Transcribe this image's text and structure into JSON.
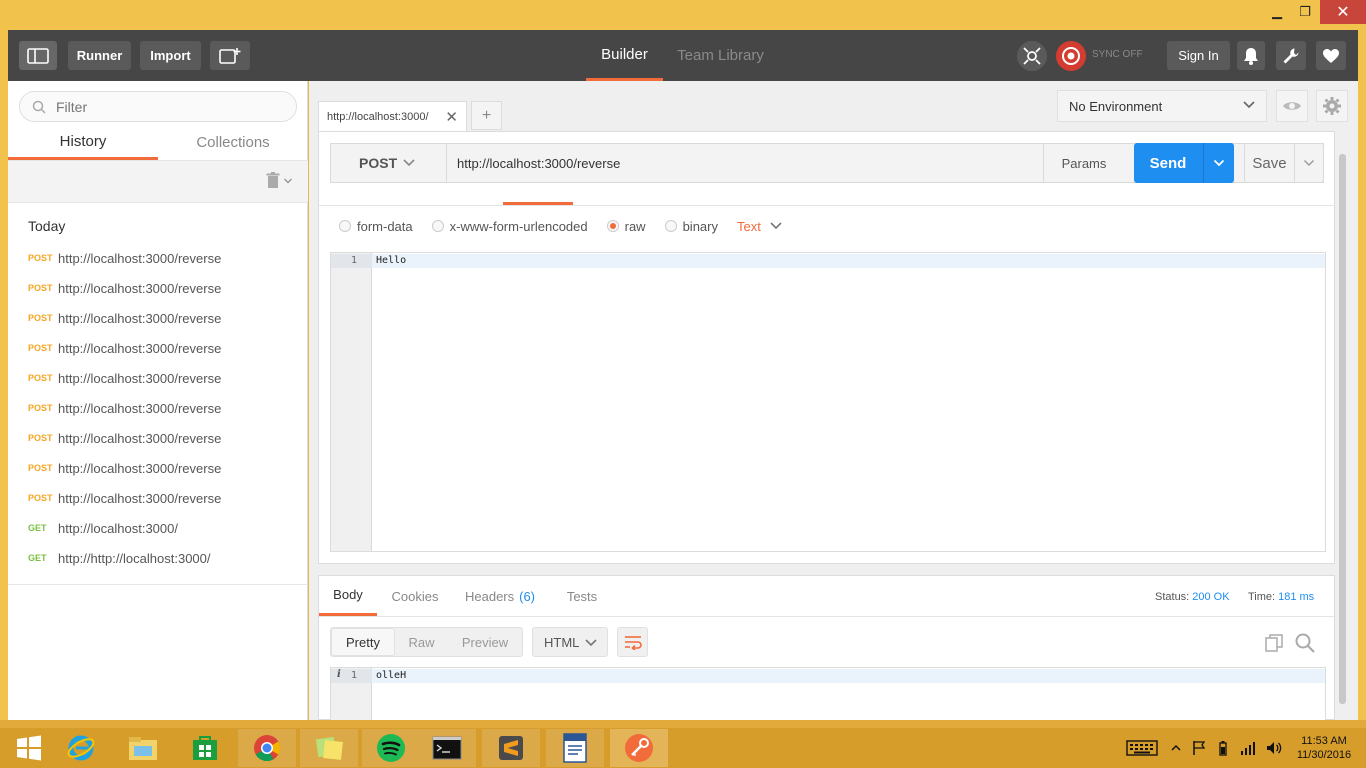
{
  "window": {
    "minimize_glyph": "▁",
    "maximize_glyph": "❐",
    "close_glyph": "✕"
  },
  "header": {
    "runner_label": "Runner",
    "import_label": "Import",
    "builder_label": "Builder",
    "team_library_label": "Team Library",
    "sync_label": "SYNC OFF",
    "sign_in_label": "Sign In",
    "icons": [
      "sidebar-toggle-icon",
      "new-window-icon",
      "interceptor-icon",
      "sync-icon",
      "bell-icon",
      "wrench-icon",
      "heart-icon"
    ],
    "accent": "#f26b3a"
  },
  "sidebar": {
    "filter_placeholder": "Filter",
    "tabs": [
      {
        "label": "History"
      },
      {
        "label": "Collections"
      }
    ],
    "today_label": "Today",
    "history": [
      {
        "method": "POST",
        "url": "http://localhost:3000/reverse"
      },
      {
        "method": "POST",
        "url": "http://localhost:3000/reverse"
      },
      {
        "method": "POST",
        "url": "http://localhost:3000/reverse"
      },
      {
        "method": "POST",
        "url": "http://localhost:3000/reverse"
      },
      {
        "method": "POST",
        "url": "http://localhost:3000/reverse"
      },
      {
        "method": "POST",
        "url": "http://localhost:3000/reverse"
      },
      {
        "method": "POST",
        "url": "http://localhost:3000/reverse"
      },
      {
        "method": "POST",
        "url": "http://localhost:3000/reverse"
      },
      {
        "method": "POST",
        "url": "http://localhost:3000/reverse"
      },
      {
        "method": "GET",
        "url": "http://localhost:3000/"
      },
      {
        "method": "GET",
        "url": "http://http://localhost:3000/"
      }
    ],
    "colors": {
      "post": "#f5a623",
      "get": "#7cc142"
    }
  },
  "request": {
    "tab_label": "http://localhost:3000/",
    "tab_close": "✕",
    "new_tab": "+",
    "environment": "No Environment",
    "method": "POST",
    "url": "http://localhost:3000/reverse",
    "params_label": "Params",
    "send_label": "Send",
    "save_label": "Save",
    "body_modes": [
      "form-data",
      "x-www-form-urlencoded",
      "raw",
      "binary"
    ],
    "selected_mode": "raw",
    "content_type": "Text",
    "body_lines": [
      {
        "num": "1",
        "text": "Hello"
      }
    ]
  },
  "response": {
    "tabs": [
      {
        "label": "Body"
      },
      {
        "label": "Cookies"
      },
      {
        "label": "Headers",
        "count": "(6)"
      },
      {
        "label": "Tests"
      }
    ],
    "status_label": "Status:",
    "status_value": "200 OK",
    "time_label": "Time:",
    "time_value": "181 ms",
    "formats": [
      "Pretty",
      "Raw",
      "Preview"
    ],
    "language": "HTML",
    "body_lines": [
      {
        "marker": "i",
        "num": "1",
        "text": "olleH"
      }
    ],
    "send_color": "#1f8ef1"
  },
  "taskbar": {
    "apps": [
      "windows-start-icon",
      "internet-explorer-icon",
      "file-explorer-icon",
      "store-icon",
      "chrome-icon",
      "sticky-notes-icon",
      "spotify-icon",
      "command-prompt-icon",
      "sublime-text-icon",
      "wordpad-icon",
      "postman-icon"
    ],
    "time": "11:53 AM",
    "date": "11/30/2016"
  }
}
